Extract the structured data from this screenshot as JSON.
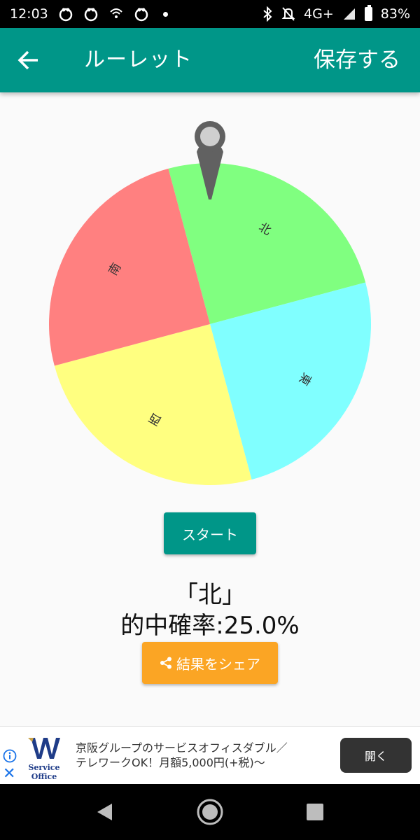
{
  "status_bar": {
    "time": "12:03",
    "network": "4G+",
    "battery": "83%"
  },
  "app_bar": {
    "title": "ルーレット",
    "save_label": "保存する"
  },
  "wheel": {
    "segments": [
      {
        "label": "北",
        "color": "#80ff80"
      },
      {
        "label": "東",
        "color": "#80ffff"
      },
      {
        "label": "西",
        "color": "#ffff80"
      },
      {
        "label": "南",
        "color": "#ff8080"
      }
    ]
  },
  "start_label": "スタート",
  "result": {
    "selected": "「北」",
    "probability": "的中確率:25.0%"
  },
  "share_label": "結果をシェア",
  "ad": {
    "logo_text_1": "Service",
    "logo_text_2": "Office",
    "line1": "京阪グループのサービスオフィスダブル／",
    "line2": "テレワークOK！月額5,000円(+税)〜",
    "open_label": "開く"
  },
  "colors": {
    "primary": "#009688",
    "accent": "#fba524",
    "background": "#fafafa"
  }
}
